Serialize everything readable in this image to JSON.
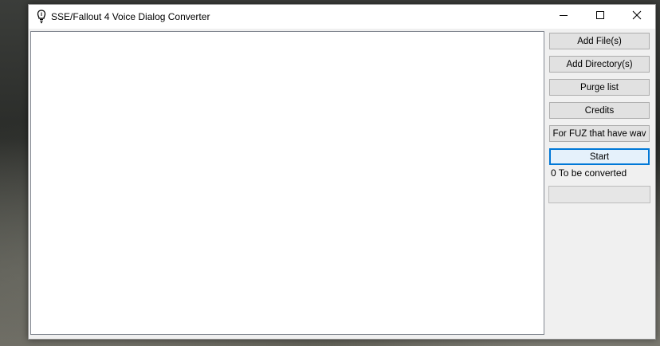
{
  "window": {
    "title": "SSE/Fallout 4 Voice Dialog Converter"
  },
  "buttons": {
    "add_files": "Add File(s)",
    "add_directory": "Add Directory(s)",
    "purge_list": "Purge list",
    "credits": "Credits",
    "fuz_wav": "For FUZ that have wav",
    "start": "Start"
  },
  "status": {
    "text": "0 To be converted"
  },
  "progress": {
    "fraction": 0
  },
  "icons": {
    "app": "app-icon",
    "minimize": "minimize-icon",
    "maximize": "maximize-icon",
    "close": "close-icon"
  }
}
